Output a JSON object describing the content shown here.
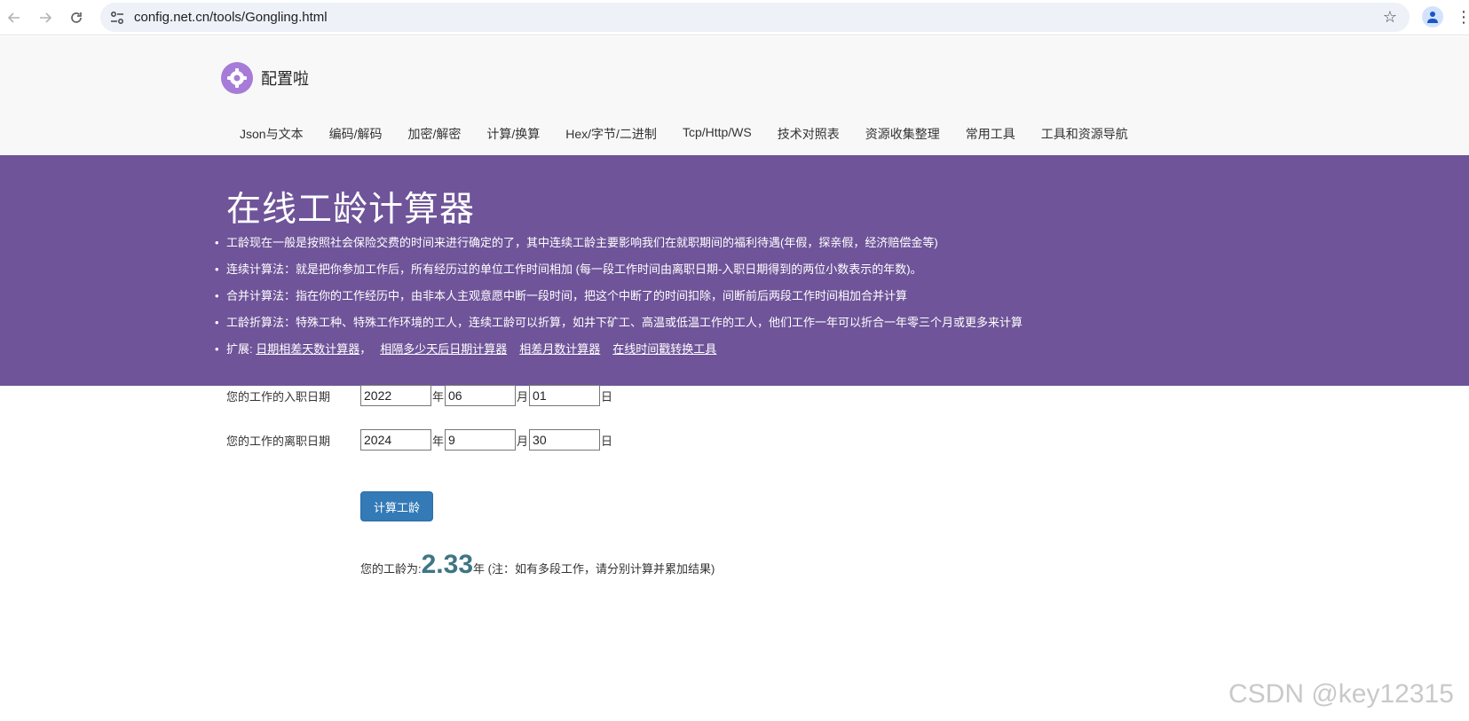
{
  "browser": {
    "url": "config.net.cn/tools/Gongling.html"
  },
  "site": {
    "logo_text": "配置啦",
    "nav": [
      "Json与文本",
      "编码/解码",
      "加密/解密",
      "计算/换算",
      "Hex/字节/二进制",
      "Tcp/Http/WS",
      "技术对照表",
      "资源收集整理",
      "常用工具",
      "工具和资源导航"
    ]
  },
  "hero": {
    "title": "在线工龄计算器",
    "bullets": [
      "工龄现在一般是按照社会保险交费的时间来进行确定的了，其中连续工龄主要影响我们在就职期间的福利待遇(年假，探亲假，经济赔偿金等)",
      "连续计算法：就是把你参加工作后，所有经历过的单位工作时间相加 (每一段工作时间由离职日期-入职日期得到的两位小数表示的年数)。",
      "合并计算法：指在你的工作经历中，由非本人主观意愿中断一段时间，把这个中断了的时间扣除，间断前后两段工作时间相加合并计算",
      "工龄折算法：特殊工种、特殊工作环境的工人，连续工龄可以折算，如井下矿工、高温或低温工作的工人，他们工作一年可以折合一年零三个月或更多来计算"
    ],
    "extend_label": "扩展: ",
    "extend_links": [
      "日期相差天数计算器",
      "相隔多少天后日期计算器",
      "相差月数计算器",
      "在线时间戳转换工具"
    ],
    "link_separator": "，"
  },
  "form": {
    "start_label": "您的工作的入职日期",
    "start_year": "2022",
    "start_month": "06",
    "start_day": "01",
    "end_label": "您的工作的离职日期",
    "end_year": "2024",
    "end_month": "9",
    "end_day": "30",
    "unit_year": "年",
    "unit_month": "月",
    "unit_day": "日",
    "button_label": "计算工龄"
  },
  "result": {
    "prefix": "您的工龄为:",
    "value": "2.33",
    "suffix": "年 (注：如有多段工作，请分别计算并累加结果)"
  },
  "watermark": "CSDN @key12315",
  "colors": {
    "hero_bg": "#6f5499",
    "button_bg": "#337ab7",
    "result_value": "#3f7584"
  }
}
